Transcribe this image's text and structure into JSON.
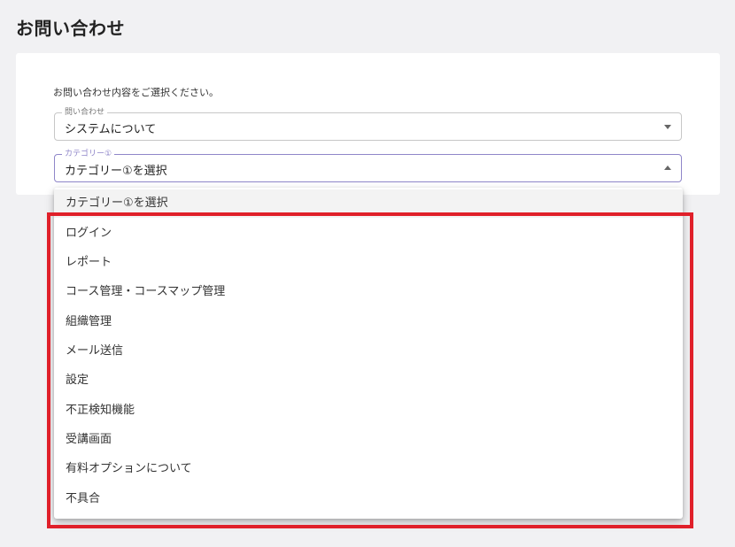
{
  "page": {
    "title": "お問い合わせ"
  },
  "form": {
    "instruction": "お問い合わせ内容をご選択ください。",
    "inquiry_field": {
      "label": "問い合わせ",
      "value": "システムについて"
    },
    "category_field": {
      "label": "カテゴリー①",
      "value": "カテゴリー①を選択"
    }
  },
  "dropdown": {
    "options": [
      "カテゴリー①を選択",
      "ログイン",
      "レポート",
      "コース管理・コースマップ管理",
      "組織管理",
      "メール送信",
      "設定",
      "不正検知機能",
      "受講画面",
      "有料オプションについて",
      "不具合"
    ]
  },
  "colors": {
    "highlight": "#e0202a",
    "focus_border": "#8f86c9",
    "page_background": "#f1f1f3"
  }
}
